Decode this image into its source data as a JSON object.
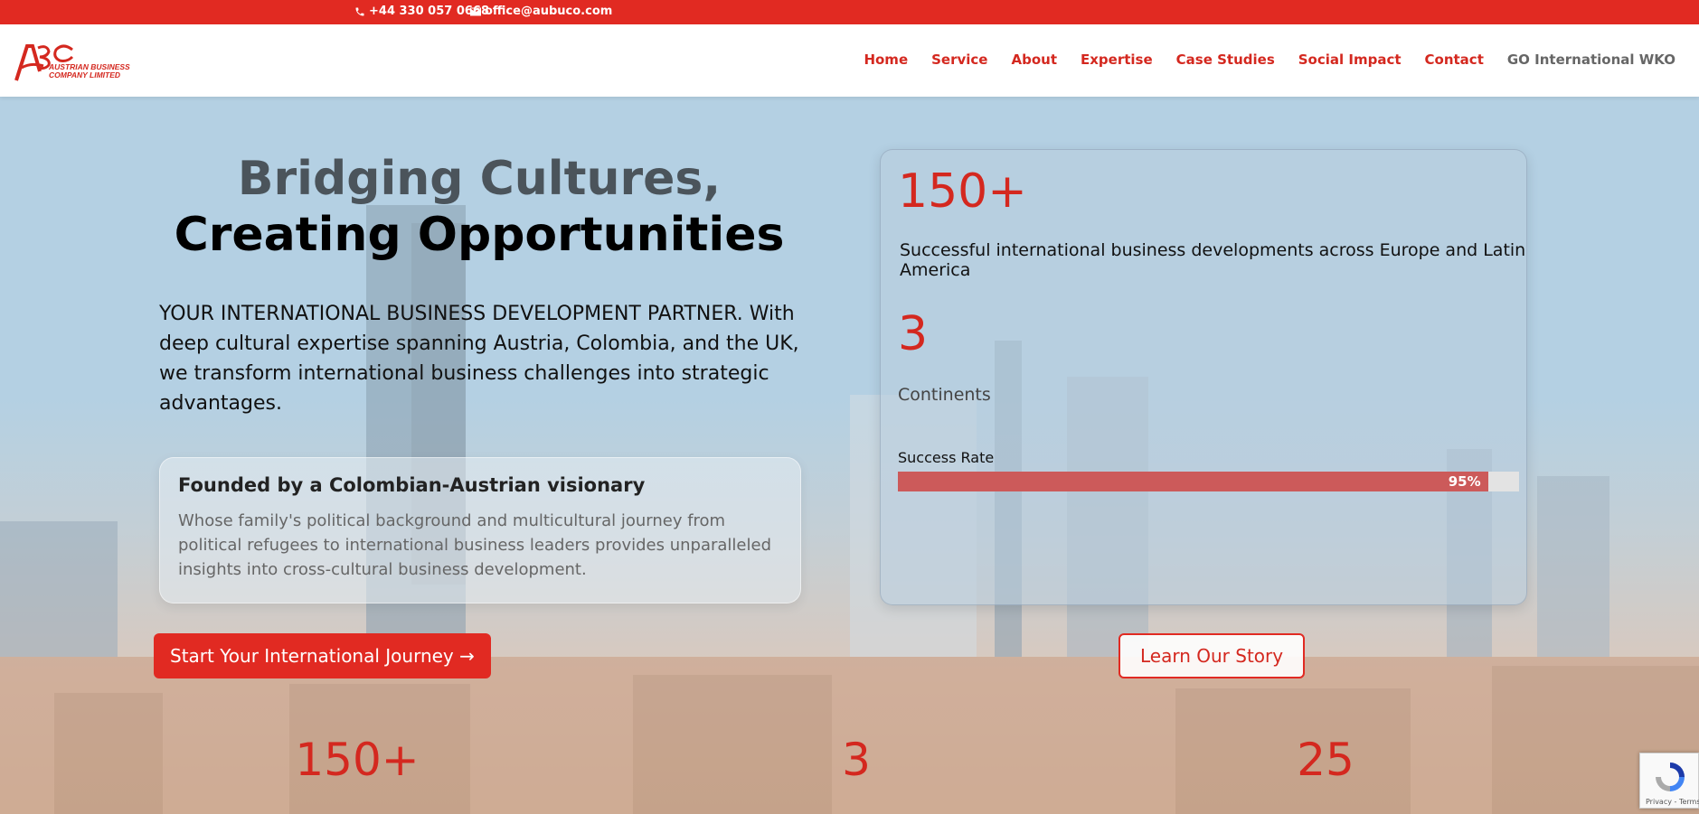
{
  "topbar": {
    "phone": "+44 330 057 0668",
    "email": "office@aubuco.com"
  },
  "logo": {
    "mark": "ABC",
    "line1": "AUSTRIAN BUSINESS",
    "line2": "COMPANY LIMITED"
  },
  "nav": [
    {
      "label": "Home"
    },
    {
      "label": "Service"
    },
    {
      "label": "About"
    },
    {
      "label": "Expertise"
    },
    {
      "label": "Case Studies"
    },
    {
      "label": "Social Impact"
    },
    {
      "label": "Contact"
    },
    {
      "label": "GO International WKO"
    }
  ],
  "hero": {
    "title_line1": "Bridging Cultures,",
    "title_line2": "Creating Opportunities",
    "intro": "YOUR INTERNATIONAL BUSINESS DEVELOPMENT PARTNER. With deep cultural expertise spanning Austria, Colombia, and the UK, we transform international business challenges into strategic advantages.",
    "founder_title": "Founded by a Colombian-Austrian visionary",
    "founder_text": "Whose family's political background and multicultural journey from political refugees to international business leaders provides unparalleled insights into cross-cultural business development.",
    "cta_primary": "Start Your International Journey →",
    "cta_secondary": "Learn Our Story"
  },
  "stats_card": {
    "stat1_value": "150+",
    "stat1_label": "Successful international business developments across Europe and Latin America",
    "stat2_value": "3",
    "stat2_label": "Continents",
    "rate_label": "Success Rate",
    "rate_percent_text": "95%",
    "rate_fraction": 0.95
  },
  "bottom_stats": [
    {
      "value": "150+"
    },
    {
      "value": "3"
    },
    {
      "value": "25"
    }
  ],
  "recaptcha": {
    "text": "Privacy - Terms"
  },
  "colors": {
    "accent": "#e12a22",
    "nav_text": "#d4281f",
    "headline_grey": "#4b545b",
    "progress_fill": "#cc5a5a"
  }
}
